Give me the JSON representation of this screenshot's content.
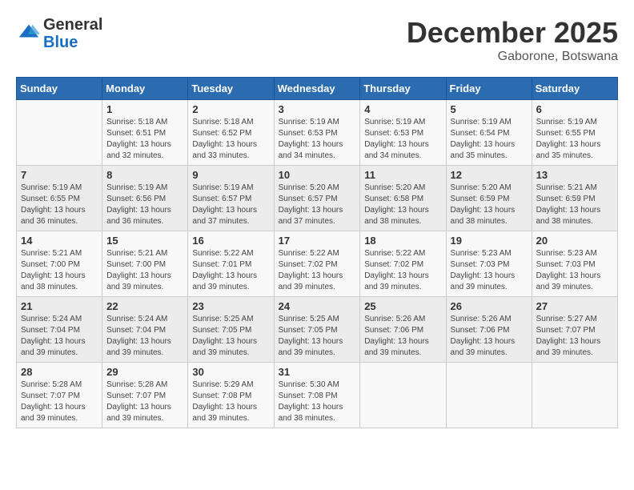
{
  "logo": {
    "general": "General",
    "blue": "Blue"
  },
  "header": {
    "month": "December 2025",
    "location": "Gaborone, Botswana"
  },
  "weekdays": [
    "Sunday",
    "Monday",
    "Tuesday",
    "Wednesday",
    "Thursday",
    "Friday",
    "Saturday"
  ],
  "weeks": [
    [
      {
        "day": "",
        "sunrise": "",
        "sunset": "",
        "daylight": ""
      },
      {
        "day": "1",
        "sunrise": "5:18 AM",
        "sunset": "6:51 PM",
        "daylight": "13 hours and 32 minutes."
      },
      {
        "day": "2",
        "sunrise": "5:18 AM",
        "sunset": "6:52 PM",
        "daylight": "13 hours and 33 minutes."
      },
      {
        "day": "3",
        "sunrise": "5:19 AM",
        "sunset": "6:53 PM",
        "daylight": "13 hours and 34 minutes."
      },
      {
        "day": "4",
        "sunrise": "5:19 AM",
        "sunset": "6:53 PM",
        "daylight": "13 hours and 34 minutes."
      },
      {
        "day": "5",
        "sunrise": "5:19 AM",
        "sunset": "6:54 PM",
        "daylight": "13 hours and 35 minutes."
      },
      {
        "day": "6",
        "sunrise": "5:19 AM",
        "sunset": "6:55 PM",
        "daylight": "13 hours and 35 minutes."
      }
    ],
    [
      {
        "day": "7",
        "sunrise": "5:19 AM",
        "sunset": "6:55 PM",
        "daylight": "13 hours and 36 minutes."
      },
      {
        "day": "8",
        "sunrise": "5:19 AM",
        "sunset": "6:56 PM",
        "daylight": "13 hours and 36 minutes."
      },
      {
        "day": "9",
        "sunrise": "5:19 AM",
        "sunset": "6:57 PM",
        "daylight": "13 hours and 37 minutes."
      },
      {
        "day": "10",
        "sunrise": "5:20 AM",
        "sunset": "6:57 PM",
        "daylight": "13 hours and 37 minutes."
      },
      {
        "day": "11",
        "sunrise": "5:20 AM",
        "sunset": "6:58 PM",
        "daylight": "13 hours and 38 minutes."
      },
      {
        "day": "12",
        "sunrise": "5:20 AM",
        "sunset": "6:59 PM",
        "daylight": "13 hours and 38 minutes."
      },
      {
        "day": "13",
        "sunrise": "5:21 AM",
        "sunset": "6:59 PM",
        "daylight": "13 hours and 38 minutes."
      }
    ],
    [
      {
        "day": "14",
        "sunrise": "5:21 AM",
        "sunset": "7:00 PM",
        "daylight": "13 hours and 38 minutes."
      },
      {
        "day": "15",
        "sunrise": "5:21 AM",
        "sunset": "7:00 PM",
        "daylight": "13 hours and 39 minutes."
      },
      {
        "day": "16",
        "sunrise": "5:22 AM",
        "sunset": "7:01 PM",
        "daylight": "13 hours and 39 minutes."
      },
      {
        "day": "17",
        "sunrise": "5:22 AM",
        "sunset": "7:02 PM",
        "daylight": "13 hours and 39 minutes."
      },
      {
        "day": "18",
        "sunrise": "5:22 AM",
        "sunset": "7:02 PM",
        "daylight": "13 hours and 39 minutes."
      },
      {
        "day": "19",
        "sunrise": "5:23 AM",
        "sunset": "7:03 PM",
        "daylight": "13 hours and 39 minutes."
      },
      {
        "day": "20",
        "sunrise": "5:23 AM",
        "sunset": "7:03 PM",
        "daylight": "13 hours and 39 minutes."
      }
    ],
    [
      {
        "day": "21",
        "sunrise": "5:24 AM",
        "sunset": "7:04 PM",
        "daylight": "13 hours and 39 minutes."
      },
      {
        "day": "22",
        "sunrise": "5:24 AM",
        "sunset": "7:04 PM",
        "daylight": "13 hours and 39 minutes."
      },
      {
        "day": "23",
        "sunrise": "5:25 AM",
        "sunset": "7:05 PM",
        "daylight": "13 hours and 39 minutes."
      },
      {
        "day": "24",
        "sunrise": "5:25 AM",
        "sunset": "7:05 PM",
        "daylight": "13 hours and 39 minutes."
      },
      {
        "day": "25",
        "sunrise": "5:26 AM",
        "sunset": "7:06 PM",
        "daylight": "13 hours and 39 minutes."
      },
      {
        "day": "26",
        "sunrise": "5:26 AM",
        "sunset": "7:06 PM",
        "daylight": "13 hours and 39 minutes."
      },
      {
        "day": "27",
        "sunrise": "5:27 AM",
        "sunset": "7:07 PM",
        "daylight": "13 hours and 39 minutes."
      }
    ],
    [
      {
        "day": "28",
        "sunrise": "5:28 AM",
        "sunset": "7:07 PM",
        "daylight": "13 hours and 39 minutes."
      },
      {
        "day": "29",
        "sunrise": "5:28 AM",
        "sunset": "7:07 PM",
        "daylight": "13 hours and 39 minutes."
      },
      {
        "day": "30",
        "sunrise": "5:29 AM",
        "sunset": "7:08 PM",
        "daylight": "13 hours and 39 minutes."
      },
      {
        "day": "31",
        "sunrise": "5:30 AM",
        "sunset": "7:08 PM",
        "daylight": "13 hours and 38 minutes."
      },
      {
        "day": "",
        "sunrise": "",
        "sunset": "",
        "daylight": ""
      },
      {
        "day": "",
        "sunrise": "",
        "sunset": "",
        "daylight": ""
      },
      {
        "day": "",
        "sunrise": "",
        "sunset": "",
        "daylight": ""
      }
    ]
  ],
  "labels": {
    "sunrise": "Sunrise:",
    "sunset": "Sunset:",
    "daylight": "Daylight:"
  }
}
